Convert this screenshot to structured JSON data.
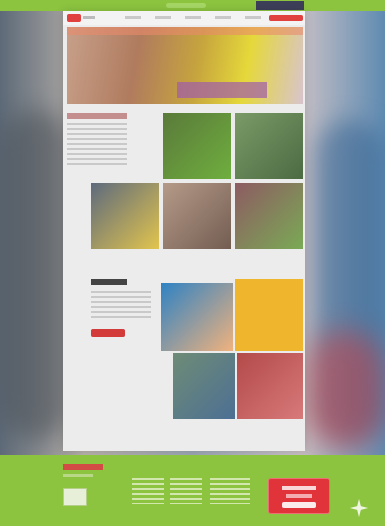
{
  "window": {
    "url": ""
  },
  "page": {
    "brand": {
      "name": ""
    },
    "nav": [
      {
        "label": ""
      },
      {
        "label": ""
      },
      {
        "label": ""
      },
      {
        "label": ""
      },
      {
        "label": ""
      },
      {
        "label": ""
      }
    ],
    "donate_label": "",
    "hero": {
      "alt": ""
    },
    "section_1": {
      "title": "",
      "body": ""
    },
    "tiles": [
      {
        "caption": ""
      },
      {
        "caption": ""
      },
      {
        "caption": ""
      },
      {
        "caption": ""
      },
      {
        "caption": ""
      }
    ],
    "section_2": {
      "title": "",
      "body": "",
      "button_label": ""
    },
    "gallery": [
      {
        "caption": ""
      },
      {
        "caption": ""
      },
      {
        "caption": ""
      },
      {
        "caption": ""
      }
    ],
    "footer": {
      "logo_text": "",
      "columns": [
        {
          "title": "",
          "items": []
        },
        {
          "title": "",
          "items": []
        },
        {
          "title": "",
          "items": []
        }
      ],
      "donate_label": ""
    }
  }
}
